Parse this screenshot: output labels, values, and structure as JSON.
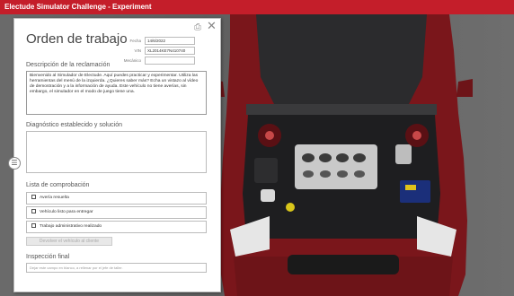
{
  "app": {
    "title": "Electude Simulator Challenge - Experiment"
  },
  "work_order": {
    "title": "Orden de trabajo",
    "fields": {
      "fecha_label": "Fecha",
      "fecha_value": "14/6/2022",
      "vin_label": "VIN",
      "vin_value": "XL2014KE7N410740",
      "mecanico_label": "Mecánico",
      "mecanico_value": ""
    },
    "description": {
      "title": "Descripción de la reclamación",
      "text": "Bienvenido al Simulador de Electude. Aquí puedes practicar y experimentar. Utiliza las herramientas del menú de la izquierda. ¿Quieres saber más? Echa un vistazo al vídeo de demostración y a la información de ayuda. Este vehículo no tiene averías, sin embargo, el simulador en el modo de juego tiene una."
    },
    "diagnosis": {
      "title": "Diagnóstico establecido y solución",
      "value": ""
    },
    "checklist": {
      "title": "Lista de comprobación",
      "items": [
        "Avería resuelta",
        "Vehículo listo para entregar",
        "Trabajo administrativo realizado"
      ]
    },
    "return_button_label": "Devolver el vehículo al cliente",
    "final_inspection": {
      "title": "Inspección final",
      "placeholder": "Dejar este campo en blanco, a rellenar por el jefe de taller."
    }
  },
  "icons": [
    "print-icon",
    "close-icon",
    "drawer-menu-icon"
  ],
  "colors": {
    "titlebar": "#c41e2a",
    "car_body": "#8a1a1f",
    "background": "#5f5f5f"
  }
}
